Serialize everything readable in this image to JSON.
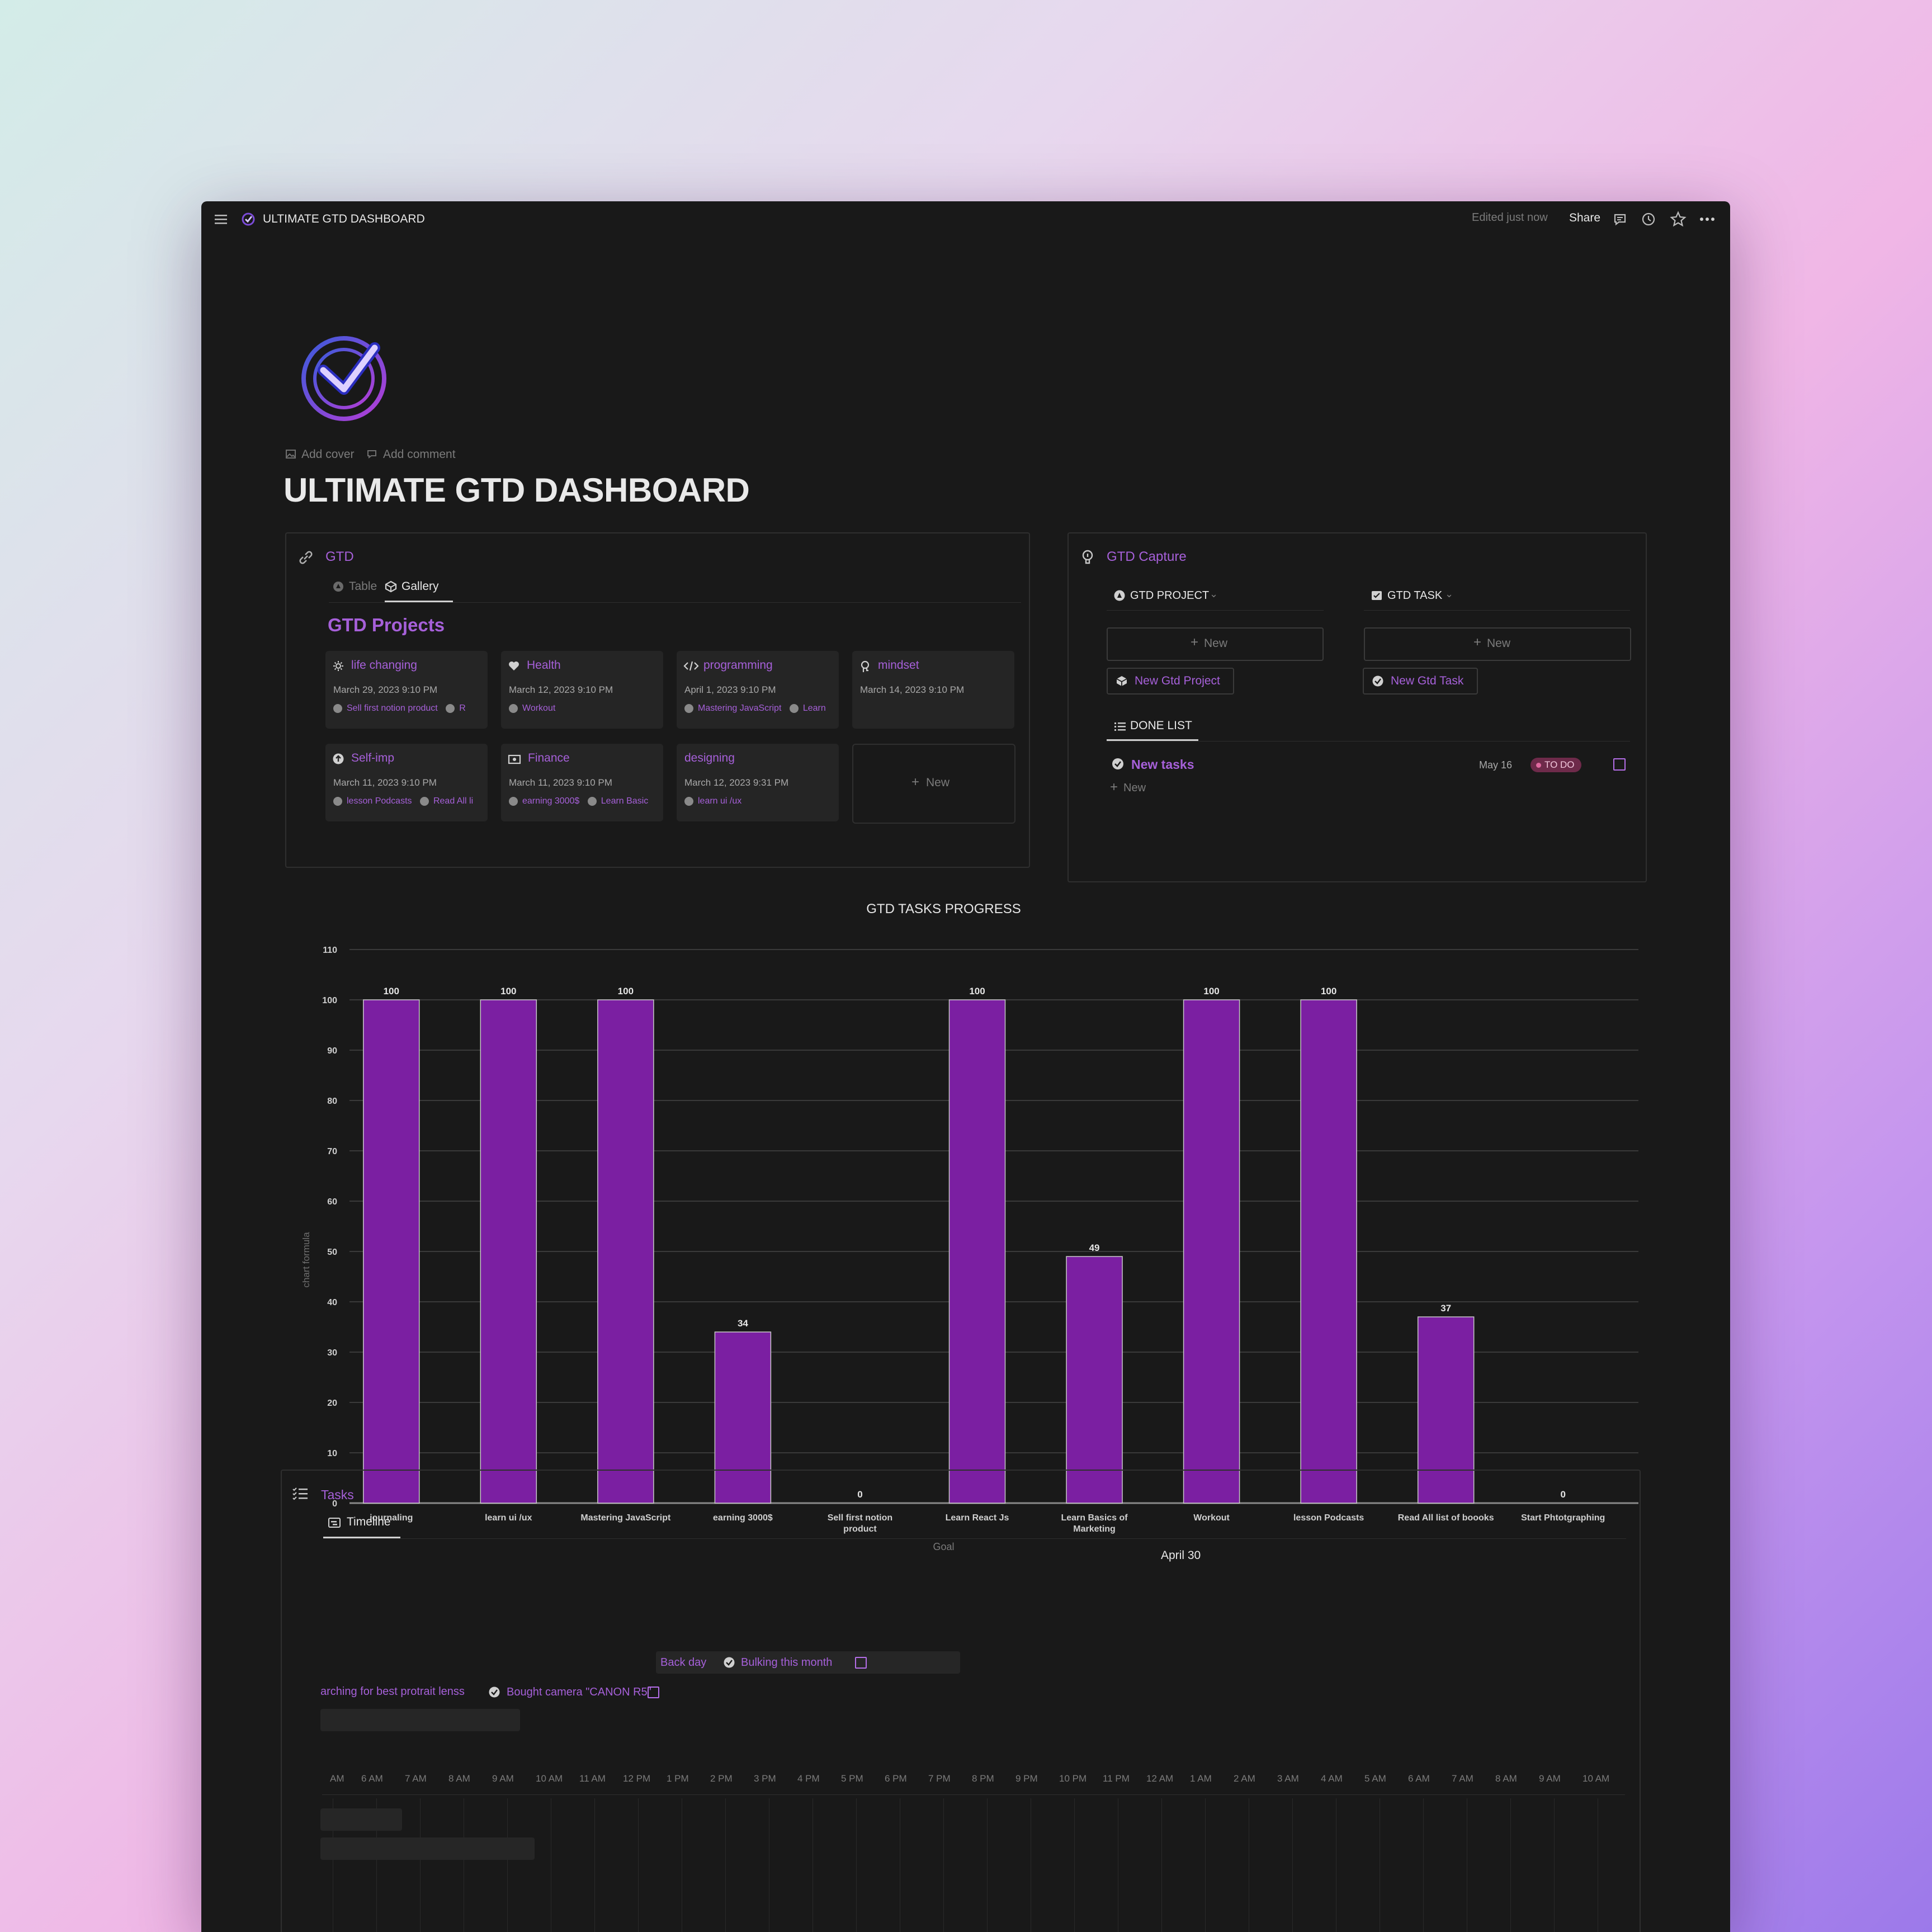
{
  "topbar": {
    "breadcrumb": "ULTIMATE GTD DASHBOARD",
    "edited": "Edited just now",
    "share": "Share"
  },
  "page": {
    "add_cover": "Add cover",
    "add_comment": "Add comment",
    "title": "ULTIMATE GTD DASHBOARD"
  },
  "gtd": {
    "db_title": "GTD",
    "tab_table": "Table",
    "tab_gallery": "Gallery",
    "gallery_title": "GTD Projects",
    "new": "New",
    "cards": [
      {
        "title": "life changing",
        "date": "March 29, 2023 9:10 PM",
        "rel1": "Sell first notion product",
        "rel2": "R",
        "icon": "gear-icon"
      },
      {
        "title": "Health",
        "date": "March 12, 2023 9:10 PM",
        "rel1": "Workout",
        "rel2": "",
        "icon": "heart-icon"
      },
      {
        "title": "programming",
        "date": "April 1, 2023 9:10 PM",
        "rel1": "Mastering JavaScript",
        "rel2": "Learn",
        "icon": "code-icon"
      },
      {
        "title": "mindset",
        "date": "March 14, 2023 9:10 PM",
        "rel1": "",
        "rel2": "",
        "icon": "head-icon"
      },
      {
        "title": "Self-imp",
        "date": "March 11, 2023 9:10 PM",
        "rel1": "lesson Podcasts",
        "rel2": "Read All li",
        "icon": "arrow-up-icon"
      },
      {
        "title": "Finance",
        "date": "March 11, 2023 9:10 PM",
        "rel1": "earning 3000$",
        "rel2": "Learn Basic",
        "icon": "money-icon"
      },
      {
        "title": "designing",
        "date": "March 12, 2023 9:31 PM",
        "rel1": "learn ui /ux",
        "rel2": "",
        "icon": ""
      }
    ]
  },
  "capture": {
    "title": "GTD Capture",
    "project_label": "GTD PROJECT",
    "task_label": "GTD TASK",
    "new": "New",
    "new_project": "New Gtd Project",
    "new_task": "New Gtd Task",
    "done_list": "DONE LIST",
    "task_name": "New tasks",
    "task_date": "May 16",
    "task_status": "TO DO",
    "add_new": "New"
  },
  "colors": {
    "accent": "#a660d9",
    "bar": "#7b1fa2",
    "background": "#191919",
    "todo_tag": "#6e2a4a"
  },
  "chart_data": {
    "type": "bar",
    "title": "GTD TASKS PROGRESS",
    "xlabel": "Goal",
    "ylabel": "chart formula",
    "ylim": [
      0,
      110
    ],
    "yticks": [
      0,
      10,
      20,
      30,
      40,
      50,
      60,
      70,
      80,
      90,
      100,
      110
    ],
    "categories": [
      "journaling",
      "learn ui /ux",
      "Mastering JavaScript",
      "earning 3000$",
      "Sell first notion product",
      "Learn React Js",
      "Learn Basics of Marketing",
      "Workout",
      "lesson Podcasts",
      "Read All list of boooks",
      "Start Phtotgraphing"
    ],
    "values": [
      100,
      100,
      100,
      34,
      0,
      100,
      49,
      100,
      100,
      37,
      0
    ],
    "grid": true
  },
  "tasks": {
    "title": "Tasks",
    "tab_timeline": "Timeline",
    "date_header": "April 30",
    "hours": [
      "AM",
      "6 AM",
      "7 AM",
      "8 AM",
      "9 AM",
      "10 AM",
      "11 AM",
      "12 PM",
      "1 PM",
      "2 PM",
      "3 PM",
      "4 PM",
      "5 PM",
      "6 PM",
      "7 PM",
      "8 PM",
      "9 PM",
      "10 PM",
      "11 PM",
      "12 AM",
      "1 AM",
      "2 AM",
      "3 AM",
      "4 AM",
      "5 AM",
      "6 AM",
      "7 AM",
      "8 AM",
      "9 AM",
      "10 AM"
    ],
    "item1_project": "Back day",
    "item1_task": "Bulking this month",
    "item2_project": "arching for best protrait lenss",
    "item2_task": "Bought camera \"CANON R5\""
  }
}
